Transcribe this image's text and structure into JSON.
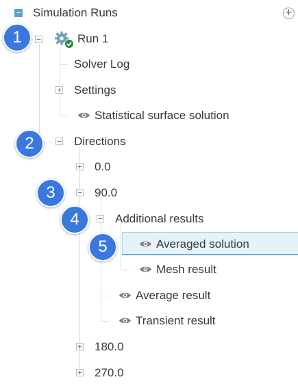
{
  "tree": {
    "root": {
      "label": "Simulation Runs",
      "add_button": "+"
    },
    "run": {
      "label": "Run 1",
      "icon": "gear-check-icon",
      "children": {
        "solver_log": "Solver Log",
        "settings": "Settings",
        "statistical_surface": "Statistical surface solution",
        "directions": {
          "label": "Directions",
          "items": {
            "d0": "0.0",
            "d90": {
              "label": "90.0",
              "additional_results": {
                "label": "Additional results",
                "averaged_solution": "Averaged solution",
                "mesh_result": "Mesh result"
              },
              "average_result": "Average result",
              "transient_result": "Transient result"
            },
            "d180": "180.0",
            "d270": "270.0"
          }
        }
      }
    }
  },
  "toggles": {
    "collapse": "−",
    "expand": "+"
  },
  "callouts": [
    "1",
    "2",
    "3",
    "4",
    "5"
  ],
  "colors": {
    "callout": "#3a78dd",
    "selected_background": "#e6f2f8",
    "selected_border": "#5eafd3",
    "root_toggle": "#5fa3c4",
    "status_check": "#2e8b3a"
  }
}
